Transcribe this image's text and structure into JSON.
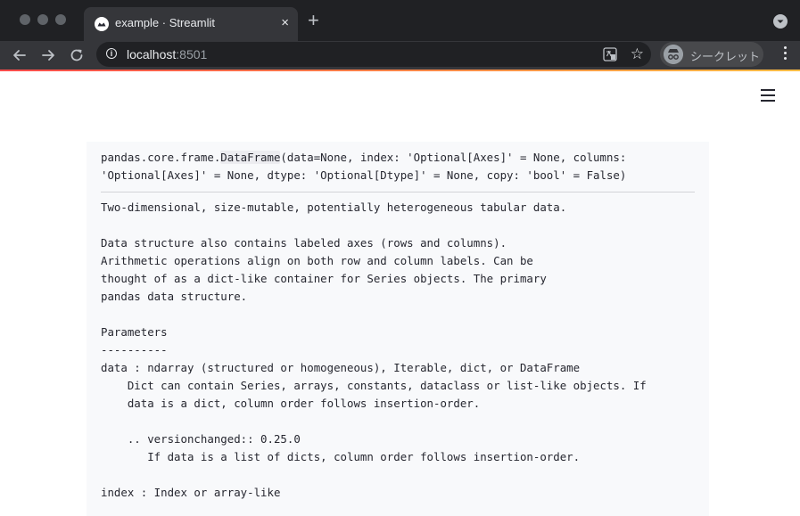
{
  "browser": {
    "tab": {
      "title": "example · Streamlit",
      "close": "×"
    },
    "new_tab": "+",
    "address": {
      "host": "localhost",
      "port": ":8501"
    },
    "incognito_label": "シークレット",
    "star": "☆"
  },
  "colors": {
    "accent_start": "#ff4b4b",
    "accent_end": "#ffbd45",
    "help_background": "#f8f9fb",
    "text": "#262730"
  },
  "help": {
    "signature": {
      "module": "pandas.core.frame.",
      "class_name": "DataFrame",
      "line1_rest": "(data=None, index: 'Optional[Axes]' = None, columns:",
      "line2": "'Optional[Axes]' = None, dtype: 'Optional[Dtype]' = None, copy: 'bool' = False)"
    },
    "docstring_lines": [
      "Two-dimensional, size-mutable, potentially heterogeneous tabular data.",
      "",
      "Data structure also contains labeled axes (rows and columns).",
      "Arithmetic operations align on both row and column labels. Can be",
      "thought of as a dict-like container for Series objects. The primary",
      "pandas data structure.",
      "",
      "Parameters",
      "----------",
      "data : ndarray (structured or homogeneous), Iterable, dict, or DataFrame",
      "    Dict can contain Series, arrays, constants, dataclass or list-like objects. If",
      "    data is a dict, column order follows insertion-order.",
      "",
      "    .. versionchanged:: 0.25.0",
      "       If data is a list of dicts, column order follows insertion-order.",
      "",
      "index : Index or array-like"
    ]
  }
}
